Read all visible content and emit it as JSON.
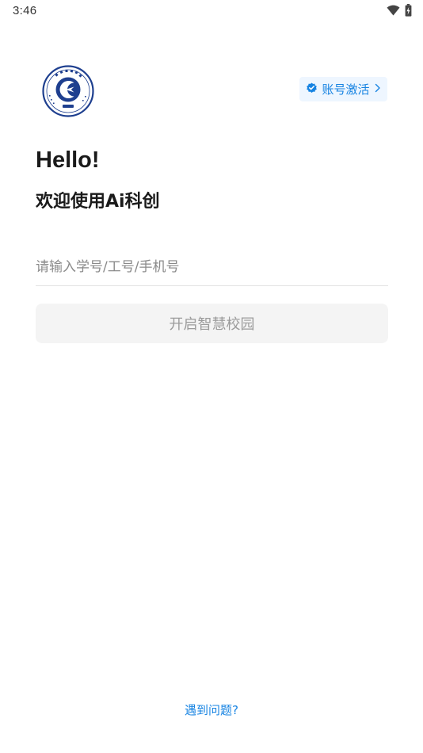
{
  "status_bar": {
    "time": "3:46",
    "icons": [
      "wifi-icon",
      "battery-charging-icon"
    ]
  },
  "header": {
    "logo": "school-emblem",
    "activate_button": {
      "label": "账号激活",
      "icon": "verified-badge-icon",
      "trailing_icon": "chevron-right-icon"
    }
  },
  "greeting": {
    "title": "Hello!",
    "subtitle": "欢迎使用Ai科创"
  },
  "login": {
    "account_placeholder": "请输入学号/工号/手机号",
    "account_value": "",
    "submit_label": "开启智慧校园"
  },
  "footer": {
    "help_label": "遇到问题?"
  },
  "colors": {
    "accent": "#1683e2",
    "activate_bg": "#eef6ff",
    "button_bg": "#f4f4f4",
    "button_text": "#9b9b9b",
    "logo_blue": "#1e3f8f"
  }
}
